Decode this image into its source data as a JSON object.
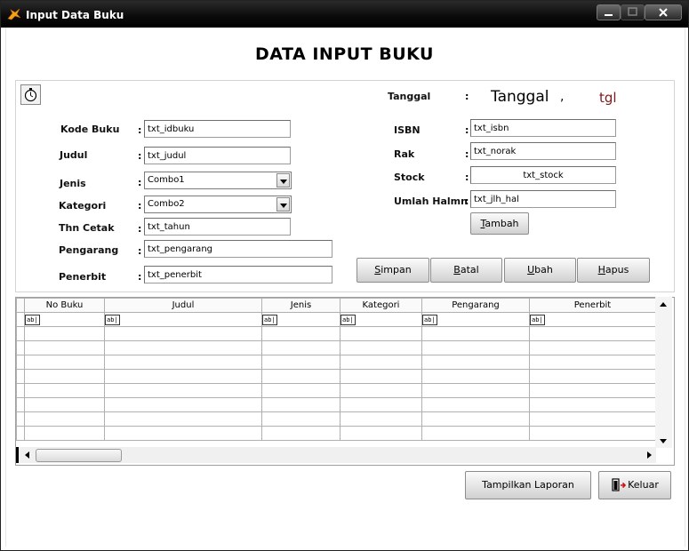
{
  "window": {
    "title": "Input Data Buku"
  },
  "heading": "DATA INPUT BUKU",
  "left_form": [
    {
      "label": "Kode Buku",
      "value": "txt_idbuku",
      "type": "text"
    },
    {
      "label": "Judul",
      "value": "txt_judul",
      "type": "text"
    },
    {
      "label": "Jenis",
      "value": "Combo1",
      "type": "combo"
    },
    {
      "label": "Kategori",
      "value": "Combo2",
      "type": "combo"
    },
    {
      "label": "Thn Cetak",
      "value": "txt_tahun",
      "type": "text"
    },
    {
      "label": "Pengarang",
      "value": "txt_pengarang",
      "type": "text"
    },
    {
      "label": "Penerbit",
      "value": "txt_penerbit",
      "type": "text"
    }
  ],
  "tanggal": {
    "label": "Tanggal",
    "value": "Tanggal",
    "separator": ",",
    "tgl": "tgl"
  },
  "right_form": [
    {
      "label": "ISBN",
      "value": "txt_isbn"
    },
    {
      "label": "Rak",
      "value": "txt_norak"
    },
    {
      "label": "Stock",
      "value": "txt_stock"
    },
    {
      "label": "Umlah Halmn",
      "value": "txt_jlh_hal"
    }
  ],
  "colon": ":",
  "buttons": {
    "tambah": {
      "key": "T",
      "rest": "ambah"
    },
    "simpan": {
      "key": "S",
      "rest": "impan"
    },
    "batal": {
      "key": "B",
      "rest": "atal"
    },
    "ubah": {
      "key": "U",
      "rest": "bah"
    },
    "hapus": {
      "key": "H",
      "rest": "apus"
    },
    "tampilkan_laporan": "Tampilkan Laporan",
    "keluar": "Keluar"
  },
  "grid": {
    "columns": [
      "No Buku",
      "Judul",
      "Jenis",
      "Kategori",
      "Pengarang",
      "Penerbit"
    ],
    "new_row_marker": "ab|"
  },
  "colors": {
    "titlebar": "#000000",
    "tgl": "#7a1a1a"
  },
  "icons": [
    "app-icon",
    "timer-icon",
    "exit-door-icon"
  ]
}
